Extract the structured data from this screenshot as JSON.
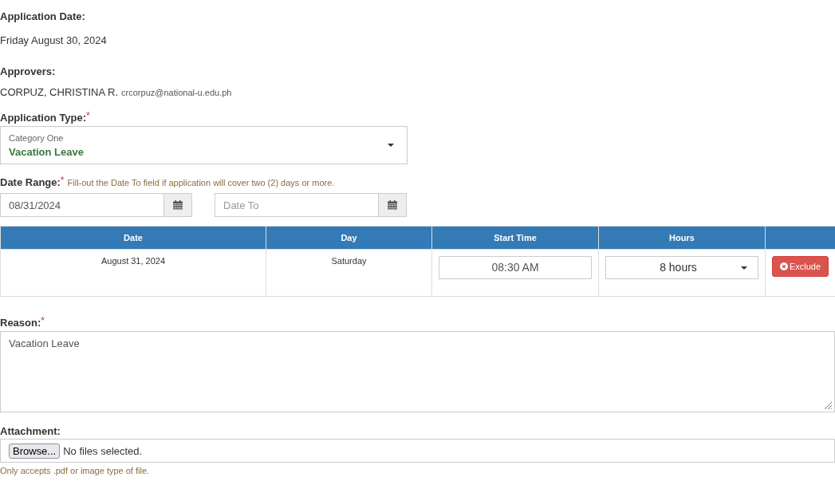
{
  "application_date": {
    "label": "Application Date:",
    "value": "Friday August 30, 2024"
  },
  "approvers": {
    "label": "Approvers:",
    "items": [
      {
        "name": "CORPUZ, CHRISTINA R.",
        "email": "crcorpuz@national-u.edu.ph"
      }
    ]
  },
  "application_type": {
    "label": "Application Type:",
    "required_mark": "*",
    "category": "Category One",
    "value": "Vacation Leave"
  },
  "date_range": {
    "label": "Date Range:",
    "required_mark": "*",
    "hint": "Fill-out the Date To field if application will cover two (2) days or more.",
    "date_from": {
      "value": "08/31/2024"
    },
    "date_to": {
      "placeholder": "Date To"
    }
  },
  "schedule_table": {
    "columns": [
      "Date",
      "Day",
      "Start Time",
      "Hours"
    ],
    "rows": [
      {
        "date": "August 31, 2024",
        "day": "Saturday",
        "start_time": "08:30 AM",
        "hours": "8 hours",
        "action": "Exclude"
      }
    ]
  },
  "reason": {
    "label": "Reason:",
    "required_mark": "*",
    "value": "Vacation Leave"
  },
  "attachment": {
    "label": "Attachment:",
    "button": "Browse...",
    "status": "No files selected.",
    "note": "Only accepts .pdf or image type of file."
  }
}
